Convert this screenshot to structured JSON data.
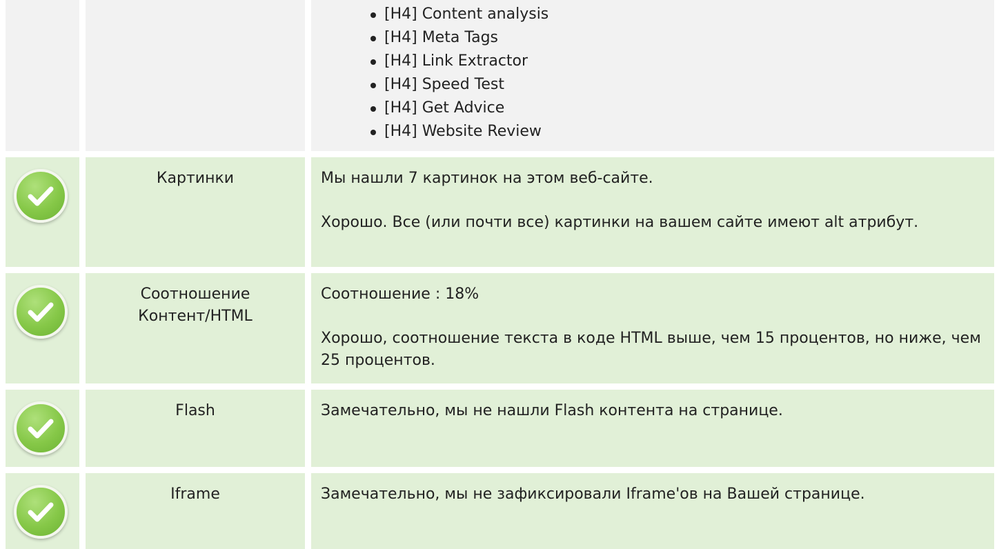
{
  "heading_list": [
    "[H4] Content analysis",
    "[H4] Meta Tags",
    "[H4] Link Extractor",
    "[H4] Speed Test",
    "[H4] Get Advice",
    "[H4] Website Review"
  ],
  "checks": [
    {
      "label": "Картинки",
      "status_icon": "check-circle-icon",
      "lines": [
        "Мы нашли 7 картинок на этом веб-сайте.",
        "Хорошо. Все (или почти все) картинки на вашем сайте имеют alt атрибут."
      ]
    },
    {
      "label": "Соотношение Контент/HTML",
      "status_icon": "check-circle-icon",
      "lines": [
        "Соотношение : 18%",
        "Хорошо, соотношение текста в коде HTML выше, чем 15 процентов, но ниже, чем 25 процентов."
      ]
    },
    {
      "label": "Flash",
      "status_icon": "check-circle-icon",
      "lines": [
        "Замечательно, мы не нашли Flash контента на странице."
      ]
    },
    {
      "label": "Iframe",
      "status_icon": "check-circle-icon",
      "lines": [
        "Замечательно, мы не зафиксировали Iframe'ов на Вашей странице."
      ]
    }
  ],
  "colors": {
    "ok_row_background": "#e1f0d7",
    "neutral_row_background": "#f2f2f2",
    "check_green": "#86c848",
    "text": "#222222"
  }
}
